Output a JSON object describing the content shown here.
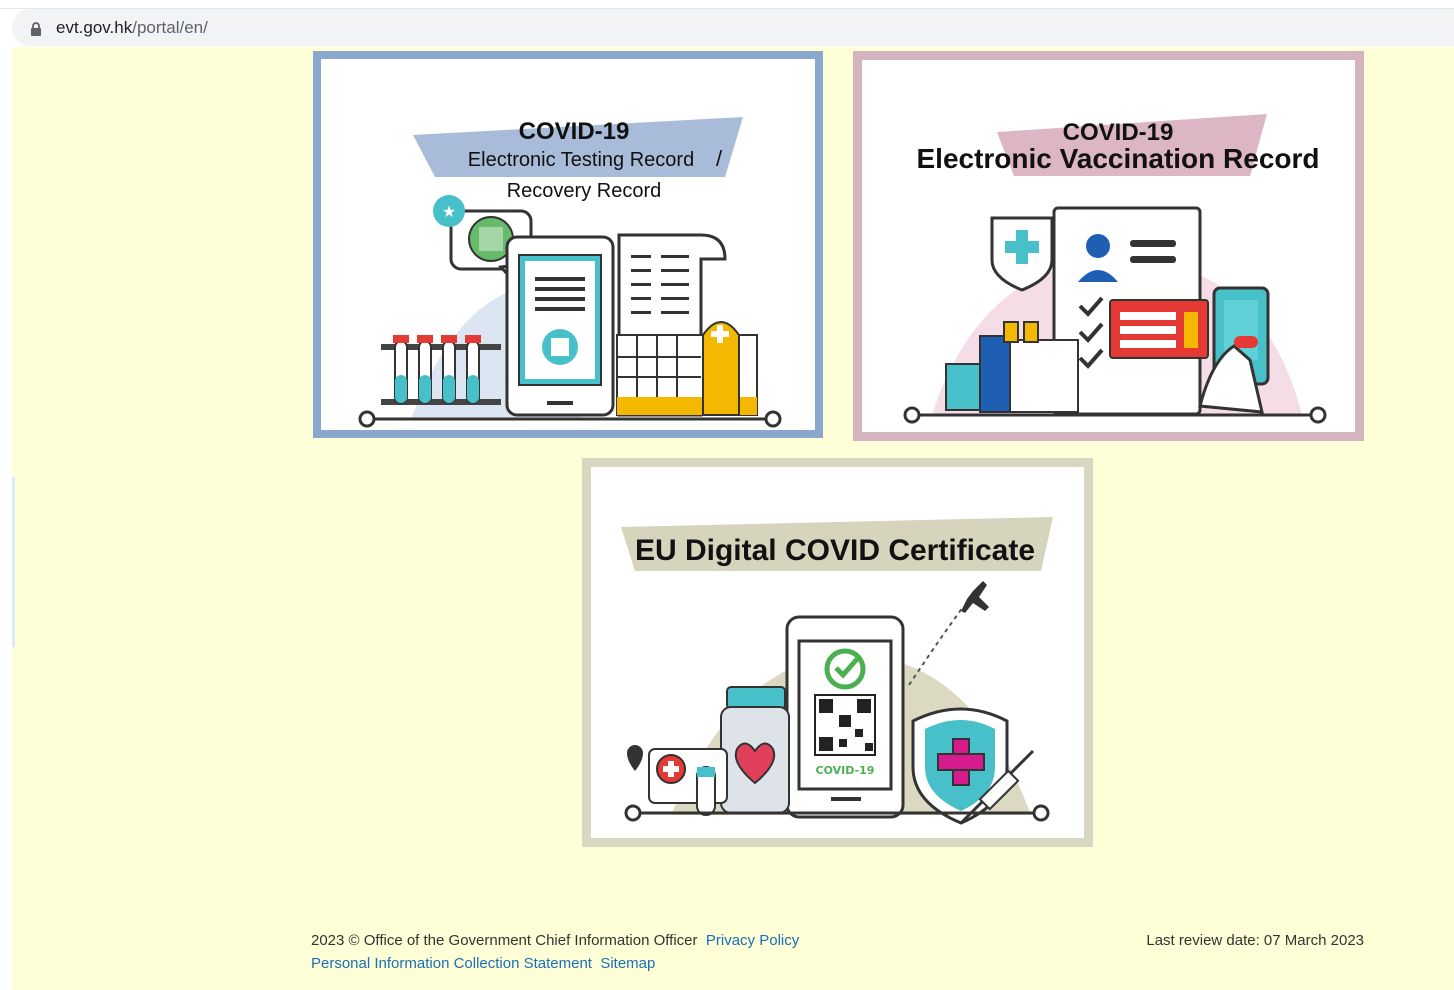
{
  "browser": {
    "url_domain": "evt.gov.hk",
    "url_path": "/portal/en/"
  },
  "cards": {
    "testing": {
      "title_line1": "COVID-19",
      "title_line2": "Electronic Testing Record",
      "title_separator": "/",
      "title_line3": "Recovery Record",
      "border_color": "#8aa7cf"
    },
    "vaccination": {
      "title_line1": "COVID-19",
      "title_line2": "Electronic Vaccination Record",
      "border_color": "#d5b4c1"
    },
    "eu": {
      "title": "EU Digital COVID Certificate",
      "phone_label": "COVID-19",
      "border_color": "#d9d7c1"
    }
  },
  "footer": {
    "copyright": "2023 © Office of the Government Chief Information Officer",
    "privacy_policy": "Privacy Policy",
    "pics": "Personal Information Collection Statement",
    "sitemap": "Sitemap",
    "last_review": "Last review date: 07 March 2023"
  },
  "colors": {
    "page_background": "#ffffd7",
    "link": "#1a6fb5"
  }
}
